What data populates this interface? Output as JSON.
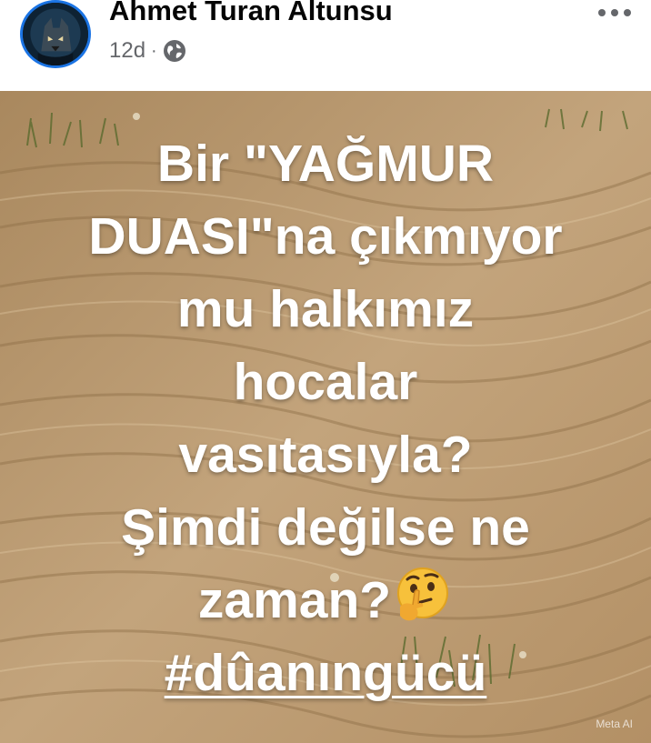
{
  "post": {
    "author": "Ahmet Turan Altunsu",
    "time": "12d",
    "separator": "·",
    "audience_icon": "globe-icon",
    "more_icon": "more-options-icon"
  },
  "image": {
    "caption_lines": [
      "Bir \"YAĞMUR",
      "DUASI\"na çıkmıyor",
      "mu halkımız",
      "hocalar",
      "vasıtasıyla?",
      "Şimdi değilse ne",
      "zaman?"
    ],
    "hashtag": "#dûanıngücü",
    "emoji": "thinking-face-emoji",
    "watermark": "Meta AI"
  },
  "colors": {
    "avatar_ring": "#1b74e4",
    "sand": "#bfa078",
    "text": "#ffffff"
  }
}
